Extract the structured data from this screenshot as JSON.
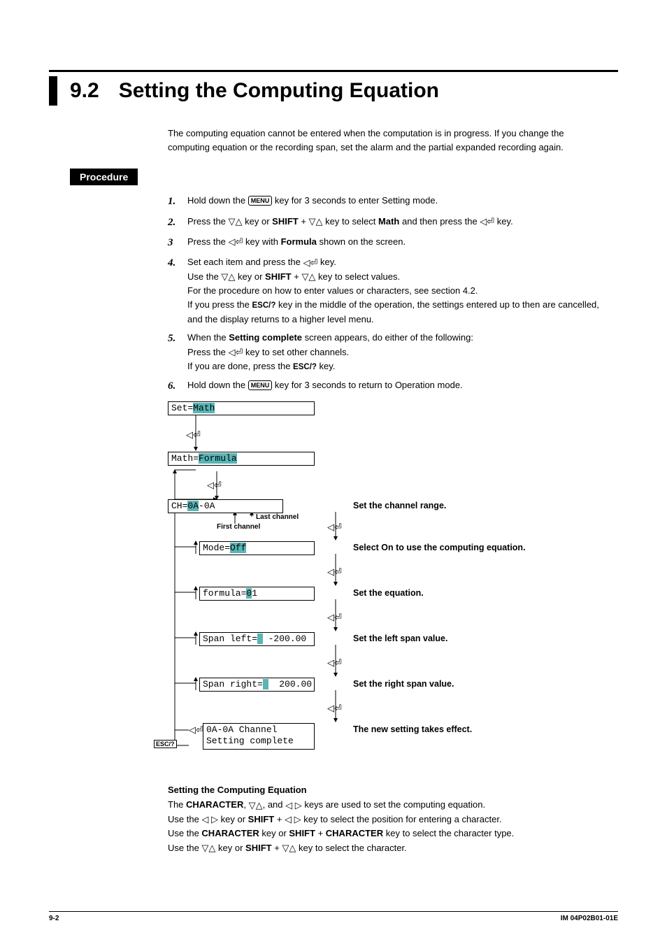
{
  "title": {
    "num": "9.2",
    "text": "Setting the Computing Equation"
  },
  "intro": "The computing equation cannot be entered when the computation is in progress. If you change the computing equation or the recording span, set the alarm and the partial expanded recording again.",
  "procedure_label": "Procedure",
  "keys": {
    "menu": "MENU",
    "esc": "ESC/?",
    "shift": "SHIFT"
  },
  "steps": {
    "s1": {
      "n": "1.",
      "a": "Hold down the ",
      "b": " key for 3 seconds to enter Setting mode."
    },
    "s2": {
      "n": "2.",
      "a": "Press the ",
      "b": " key or ",
      "c": " + ",
      "d": " key to select ",
      "math": "Math",
      "e": " and then press the ",
      "f": " key."
    },
    "s3": {
      "n": "3",
      "a": "Press the ",
      "b": " key with ",
      "formula": "Formula",
      "c": " shown on the screen."
    },
    "s4": {
      "n": "4.",
      "a": "Set each item and press the ",
      "b": " key.",
      "l2a": "Use the ",
      "l2b": " key or ",
      "l2c": " + ",
      "l2d": " key to select values.",
      "l3": "For the procedure on how to enter values or characters, see section 4.2.",
      "l4a": "If you press the ",
      "l4b": " key in the middle of the operation, the settings entered up to then are cancelled, and the display returns to a higher level menu."
    },
    "s5": {
      "n": "5.",
      "a": "When the ",
      "sc": "Setting complete",
      "b": " screen appears, do either of the following:",
      "l2a": "Press the ",
      "l2b": " key to set other channels.",
      "l3a": "If you are done, press the ",
      "l3b": " key."
    },
    "s6": {
      "n": "6.",
      "a": "Hold down the ",
      "b": " key for 3 seconds to return to Operation mode."
    }
  },
  "diagram": {
    "set_prefix": "Set=",
    "set_value": "Math",
    "math_prefix": "Math=",
    "math_value": "Formula",
    "ch_prefix": "CH=",
    "ch_v1": "0A",
    "ch_mid": "-0A",
    "mode_prefix": "Mode=",
    "mode_value": "Off",
    "formula_prefix": "formula=",
    "formula_hl": "0",
    "formula_rest": "1",
    "spanl_prefix": "Span left=",
    "spanl_cursor": " ",
    "spanl_value": " -200.00",
    "spanr_prefix": "Span right=",
    "spanr_cursor": " ",
    "spanr_value": "  200.00",
    "complete_l1": "0A-0A Channel",
    "complete_l2": "Setting complete",
    "first_ch": "First channel",
    "last_ch": "Last channel",
    "lbl_ch": "Set the channel range.",
    "lbl_mode": "Select On to use the computing equation.",
    "lbl_formula": "Set the equation.",
    "lbl_spanl": "Set the left span value.",
    "lbl_spanr": "Set the right span value.",
    "lbl_complete": "The new setting takes effect.",
    "esc": "ESC/?"
  },
  "bottom": {
    "head": "Setting the Computing Equation",
    "p1a": "The ",
    "char": "CHARACTER",
    "p1b": ", ",
    "p1c": ", and ",
    "p1d": " keys are used to set the computing equation.",
    "p2a": "Use the ",
    "p2b": " key or ",
    "p2c": " + ",
    "p2d": " key to select the position for entering a character.",
    "p3a": "Use the ",
    "p3b": " key or ",
    "p3c": " + ",
    "p3d": " key to select the character type.",
    "p4a": "Use the ",
    "p4b": " key or ",
    "p4c": " + ",
    "p4d": " key to select the character."
  },
  "footer": {
    "page": "9-2",
    "doc": "IM 04P02B01-01E"
  }
}
